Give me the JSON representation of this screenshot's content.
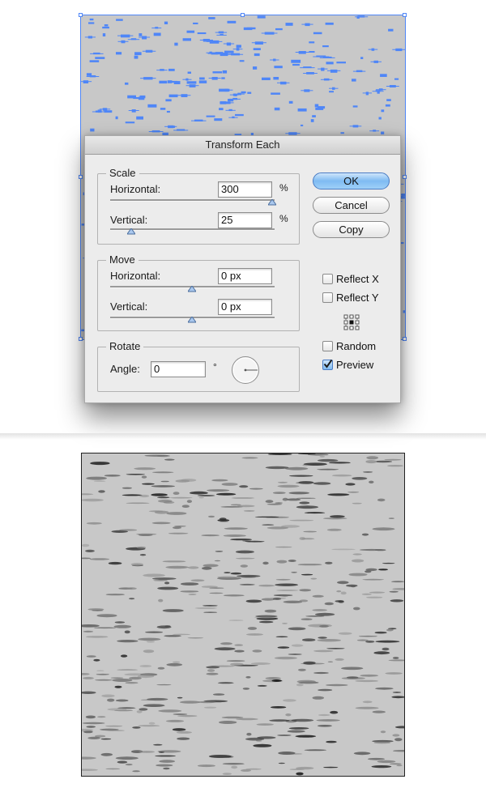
{
  "dialog": {
    "title": "Transform Each",
    "scale": {
      "legend": "Scale",
      "horizontal_label": "Horizontal:",
      "horizontal_value": "300",
      "horizontal_unit": "%",
      "vertical_label": "Vertical:",
      "vertical_value": "25",
      "vertical_unit": "%"
    },
    "move": {
      "legend": "Move",
      "horizontal_label": "Horizontal:",
      "horizontal_value": "0 px",
      "vertical_label": "Vertical:",
      "vertical_value": "0 px"
    },
    "rotate": {
      "legend": "Rotate",
      "angle_label": "Angle:",
      "angle_value": "0",
      "angle_unit": "°"
    },
    "buttons": {
      "ok": "OK",
      "cancel": "Cancel",
      "copy": "Copy"
    },
    "options": {
      "reflect_x": {
        "label": "Reflect X",
        "checked": false
      },
      "reflect_y": {
        "label": "Reflect Y",
        "checked": false
      },
      "random": {
        "label": "Random",
        "checked": false
      },
      "preview": {
        "label": "Preview",
        "checked": true
      }
    }
  },
  "colors": {
    "selection": "#4f86f7",
    "artboard": "#c8c8c8",
    "texture_dark": "#2a2a2a"
  },
  "icons": [
    "reference-point-icon",
    "angle-dial-icon",
    "slider-thumb-icon",
    "checkmark-icon"
  ]
}
